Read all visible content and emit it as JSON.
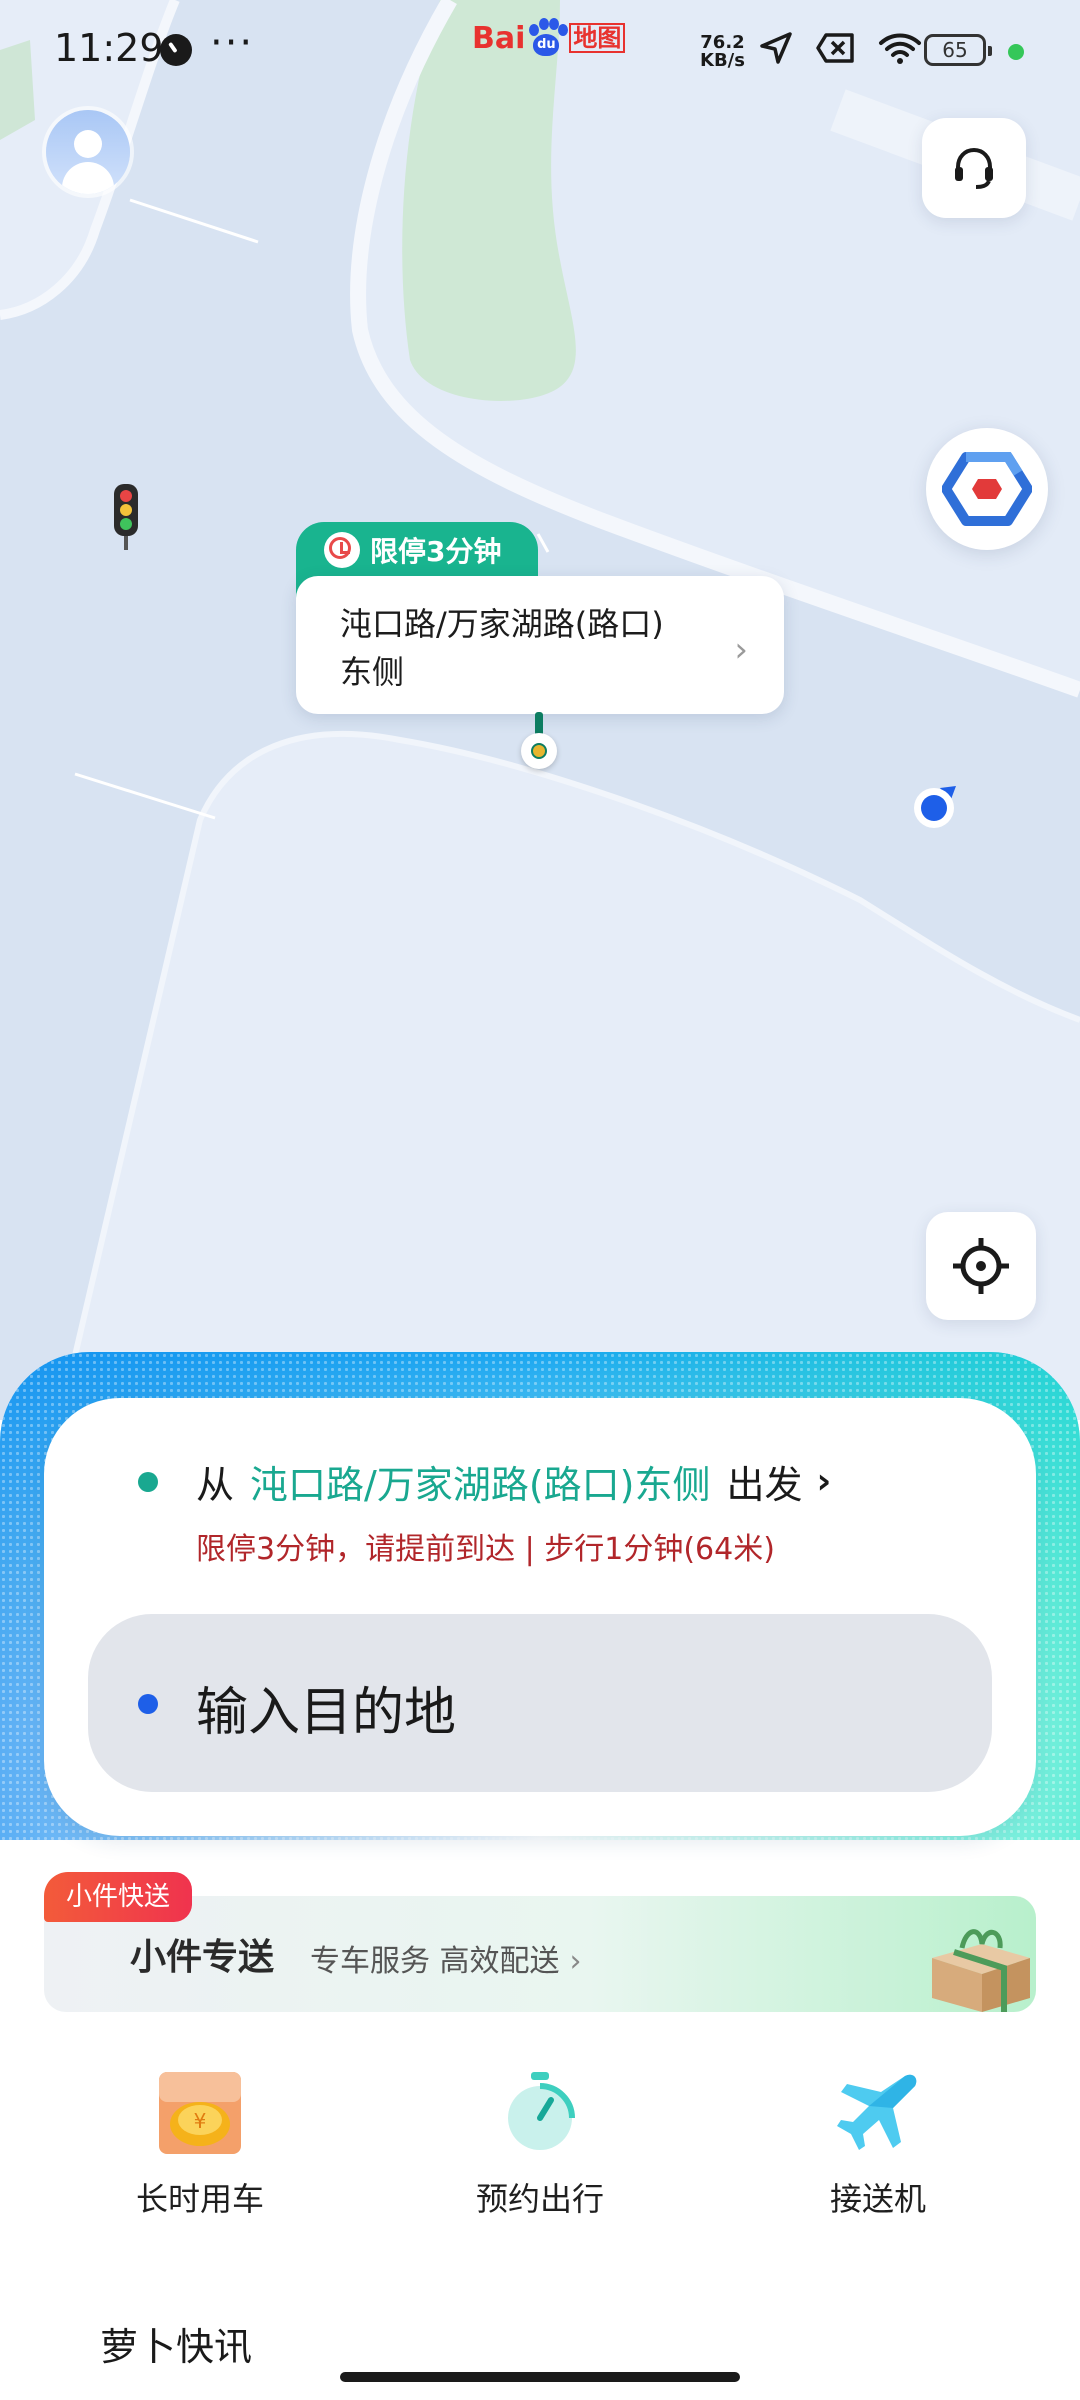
{
  "status_bar": {
    "time": "11:29",
    "dots": "···",
    "logo_prefix": "Bai",
    "logo_paw": "du",
    "logo_suffix": "地图",
    "net_speed_value": "76.2",
    "net_speed_unit": "KB/s",
    "battery": "65",
    "icons": [
      "location-arrow-icon",
      "sim-off-icon",
      "wifi-icon"
    ]
  },
  "map": {
    "pickup_tag": "限停3分钟",
    "pickup_line1": "沌口路/万家湖路(路口)",
    "pickup_line2": "东侧"
  },
  "route": {
    "from_prefix": "从",
    "from_place": "沌口路/万家湖路(路口)东侧",
    "from_suffix": "出发",
    "from_note": "限停3分钟，请提前到达 | 步行1分钟(64米)",
    "destination_placeholder": "输入目的地"
  },
  "promo": {
    "tag": "小件快送",
    "title": "小件专送",
    "subtitle": "专车服务 高效配送"
  },
  "services": [
    {
      "label": "长时用车",
      "icon": "coin-car-icon"
    },
    {
      "label": "预约出行",
      "icon": "timer-icon"
    },
    {
      "label": "接送机",
      "icon": "airplane-icon"
    }
  ],
  "news": {
    "title": "萝卜快讯"
  },
  "colors": {
    "accent_green": "#19a890",
    "tag_green": "#19b48f",
    "warning_red": "#b1262a",
    "location_blue": "#1e5fe8",
    "map_bg": "#dbe6f4"
  }
}
